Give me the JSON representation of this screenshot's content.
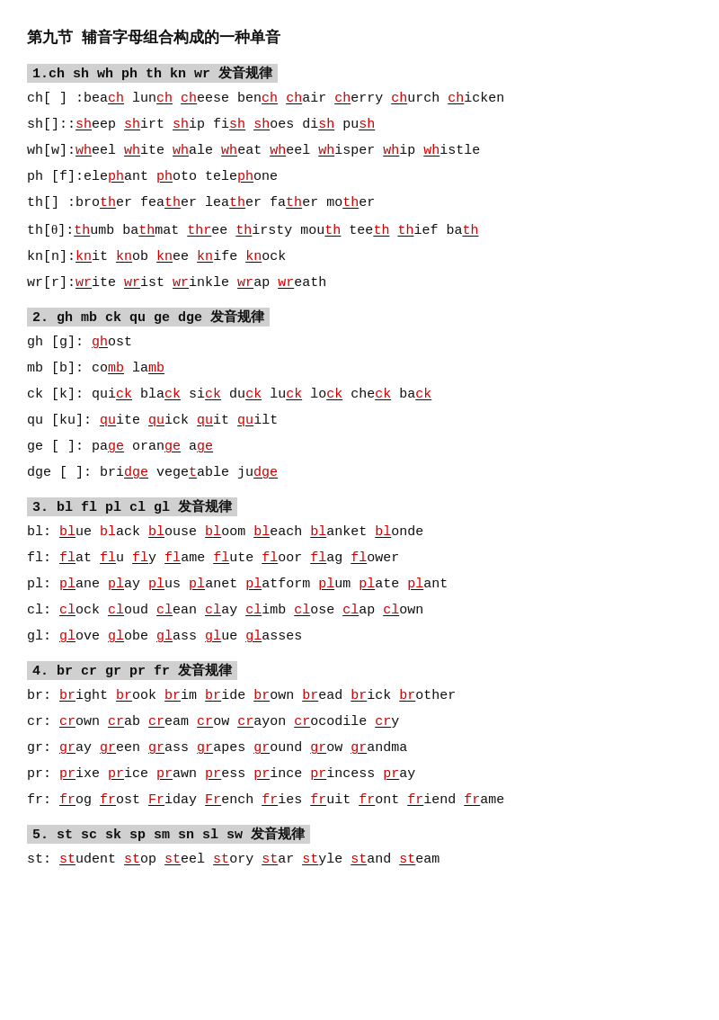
{
  "title": "第九节 辅音字母组合构成的一种单音",
  "sections": [
    {
      "id": "section1",
      "header": "1. ch sh wh ph th kn wr 发音规律",
      "lines": []
    }
  ]
}
